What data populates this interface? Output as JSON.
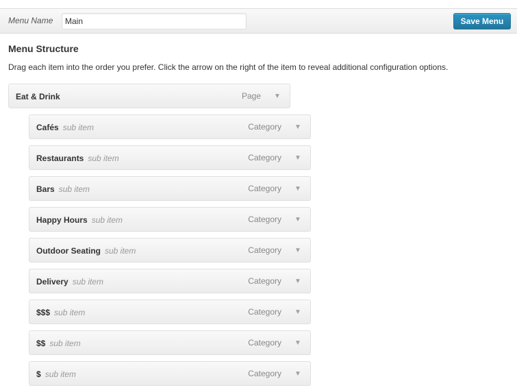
{
  "header": {
    "menu_name_label": "Menu Name",
    "menu_name_value": "Main",
    "save_label": "Save Menu"
  },
  "structure": {
    "title": "Menu Structure",
    "instructions": "Drag each item into the order you prefer. Click the arrow on the right of the item to reveal additional configuration options."
  },
  "top_item": {
    "title": "Eat & Drink",
    "type": "Page"
  },
  "sub_items": [
    {
      "title": "Cafés",
      "subtype": "sub item",
      "type": "Category"
    },
    {
      "title": "Restaurants",
      "subtype": "sub item",
      "type": "Category"
    },
    {
      "title": "Bars",
      "subtype": "sub item",
      "type": "Category"
    },
    {
      "title": "Happy Hours",
      "subtype": "sub item",
      "type": "Category"
    },
    {
      "title": "Outdoor Seating",
      "subtype": "sub item",
      "type": "Category"
    },
    {
      "title": "Delivery",
      "subtype": "sub item",
      "type": "Category"
    },
    {
      "title": "$$$",
      "subtype": "sub item",
      "type": "Category"
    },
    {
      "title": "$$",
      "subtype": "sub item",
      "type": "Category"
    },
    {
      "title": "$",
      "subtype": "sub item",
      "type": "Category"
    }
  ],
  "icons": {
    "toggle": "arrow-down-icon"
  },
  "colors": {
    "accent": "#21759b",
    "item_background": "#f1f1f1",
    "border": "#dfdfdf"
  }
}
